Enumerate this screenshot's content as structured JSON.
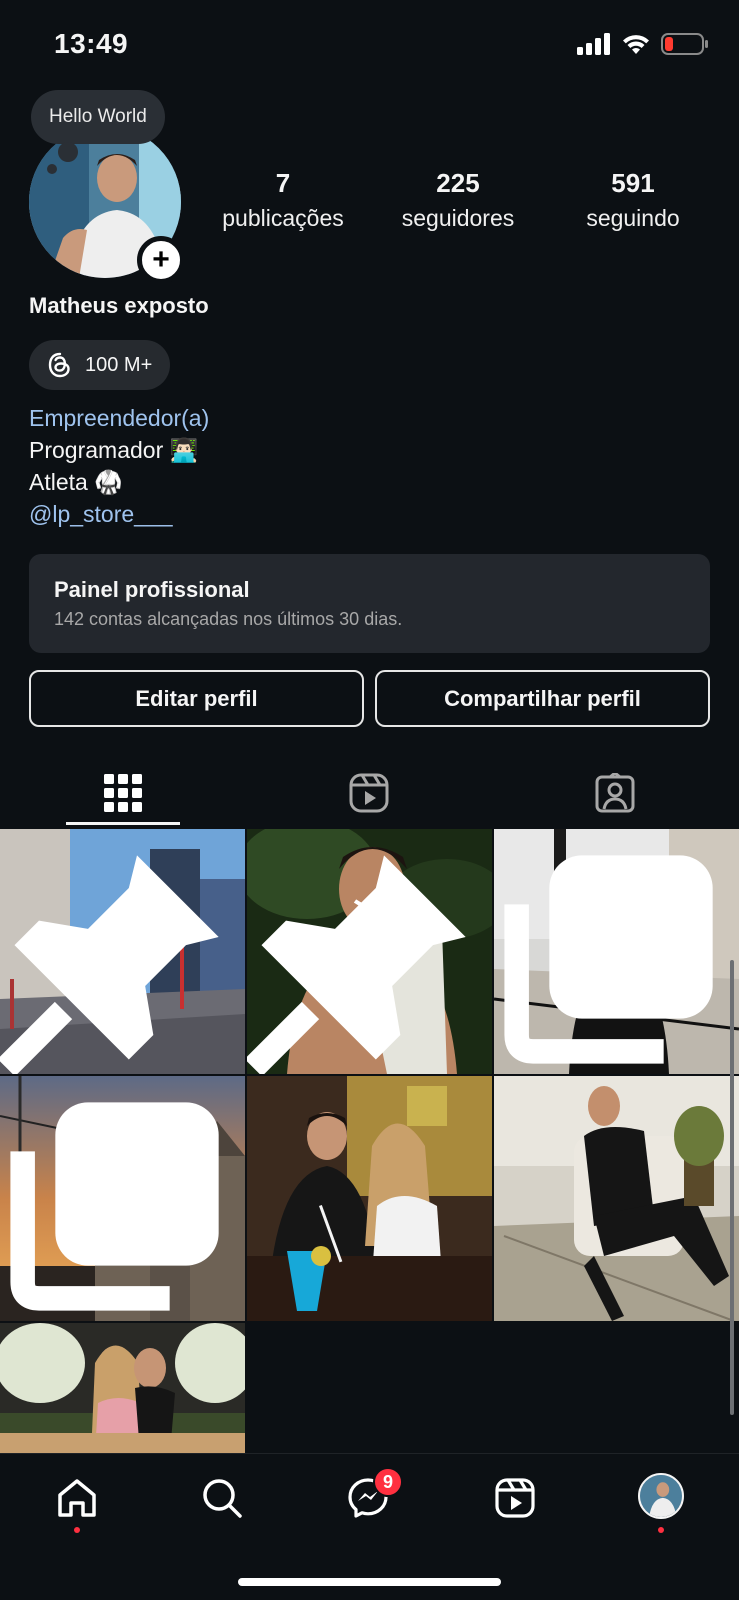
{
  "status_bar": {
    "time": "13:49"
  },
  "profile": {
    "note": "Hello World",
    "name": "Matheus exposto",
    "threads_label": "100 M+",
    "stats": [
      {
        "value": "7",
        "label": "publicações"
      },
      {
        "value": "225",
        "label": "seguidores"
      },
      {
        "value": "591",
        "label": "seguindo"
      }
    ],
    "bio": {
      "category": "Empreendedor(a)",
      "line1": "Programador 👨🏻‍💻",
      "line2": "Atleta 🥋",
      "mention": "@lp_store___"
    }
  },
  "professional_panel": {
    "title": "Painel profissional",
    "subtitle": "142 contas alcançadas nos últimos 30 dias."
  },
  "buttons": {
    "edit": "Editar perfil",
    "share": "Compartilhar perfil"
  },
  "tabs": [
    {
      "icon": "grid-icon",
      "active": true
    },
    {
      "icon": "reels-icon",
      "active": false
    },
    {
      "icon": "tagged-icon",
      "active": false
    }
  ],
  "posts": [
    {
      "scene": "city-street",
      "overlay": "pin-icon"
    },
    {
      "scene": "portrait-night",
      "overlay": "pin-icon"
    },
    {
      "scene": "rooftop-portrait",
      "overlay": "carousel-icon"
    },
    {
      "scene": "church-sunset",
      "overlay": "carousel-icon"
    },
    {
      "scene": "couple-restaurant",
      "overlay": null
    },
    {
      "scene": "armchair-portrait",
      "overlay": null
    },
    {
      "scene": "wedding-couple",
      "overlay": null
    }
  ],
  "bottom_nav": {
    "items": [
      "home-icon",
      "search-icon",
      "messenger-icon",
      "reels-icon",
      "profile-avatar"
    ],
    "messages_badge": "9"
  },
  "colors": {
    "background": "#0c1014",
    "link": "#9fc3ee",
    "notification": "#ff3040",
    "panel": "#23272d"
  }
}
